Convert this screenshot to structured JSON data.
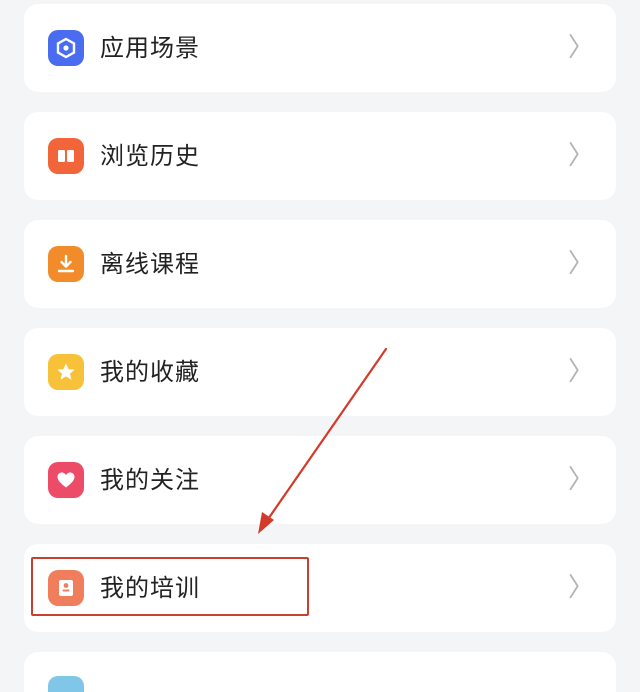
{
  "menu": {
    "items": [
      {
        "label": "应用场景",
        "icon": "hexagon-nodes-icon",
        "color": "#4a6cf0",
        "chevron": "〉"
      },
      {
        "label": "浏览历史",
        "icon": "open-book-icon",
        "color": "#f2643a",
        "chevron": "〉"
      },
      {
        "label": "离线课程",
        "icon": "download-icon",
        "color": "#f28c2b",
        "chevron": "〉"
      },
      {
        "label": "我的收藏",
        "icon": "star-icon",
        "color": "#f7c23a",
        "chevron": "〉"
      },
      {
        "label": "我的关注",
        "icon": "heart-icon",
        "color": "#ec4c68",
        "chevron": "〉"
      },
      {
        "label": "我的培训",
        "icon": "training-card-icon",
        "color": "#f07e5c",
        "chevron": "〉"
      }
    ]
  },
  "annotation": {
    "color": "#c8402e"
  }
}
